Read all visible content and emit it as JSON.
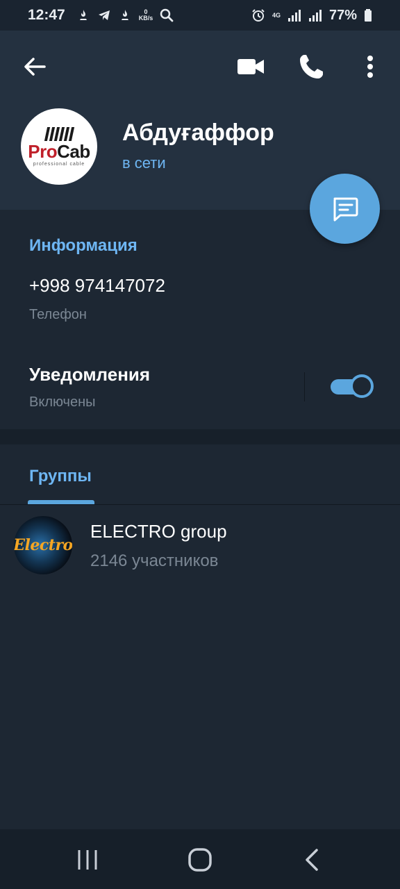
{
  "status_bar": {
    "time": "12:47",
    "kbs_value": "0",
    "kbs_unit": "KB/s",
    "network": "4G",
    "battery": "77%"
  },
  "header": {
    "name": "Абдуғаффор",
    "status": "в сети",
    "avatar_brand_pro": "Pro",
    "avatar_brand_cab": "Cab",
    "avatar_subtitle": "professional cable",
    "icons": [
      "back-arrow-icon",
      "video-camera-icon",
      "phone-icon",
      "more-vertical-icon",
      "message-icon"
    ]
  },
  "info": {
    "title": "Информация",
    "phone": "+998 974147072",
    "phone_label": "Телефон",
    "notifications_label": "Уведомления",
    "notifications_status": "Включены",
    "notifications_enabled": true
  },
  "groups": {
    "tab_label": "Группы",
    "items": [
      {
        "name": "ELECTRO group",
        "members": "2146 участников",
        "avatar_text": "Electro"
      }
    ]
  },
  "colors": {
    "accent": "#5ba6de",
    "link": "#6eb6f3",
    "background": "#1d2733",
    "header": "#243140"
  }
}
